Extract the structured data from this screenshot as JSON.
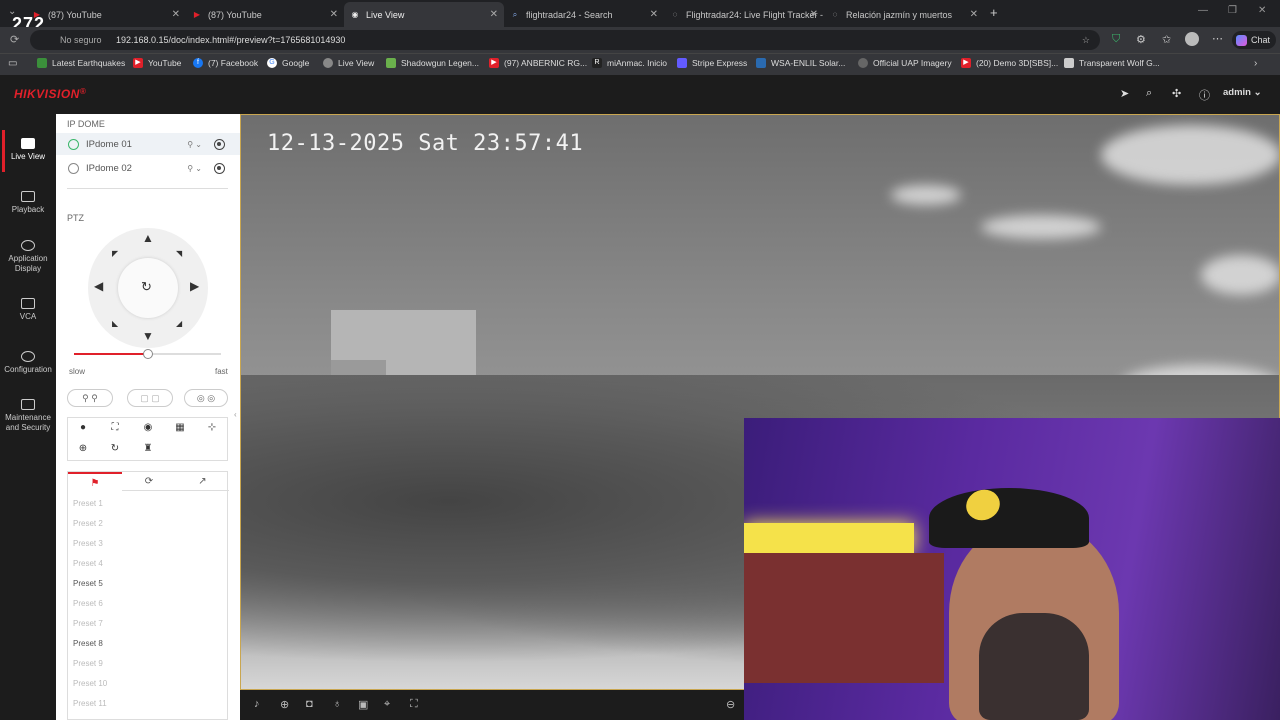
{
  "browser": {
    "tabs": [
      {
        "title": "(87) YouTube",
        "icon": "youtube-icon"
      },
      {
        "title": "(87) YouTube",
        "icon": "youtube-icon"
      },
      {
        "title": "Live View",
        "icon": "page-icon"
      },
      {
        "title": "flightradar24 - Search",
        "icon": "search-icon"
      },
      {
        "title": "Flightradar24: Live Flight Tracker -",
        "icon": "globe-icon"
      },
      {
        "title": "Relación jazmín y muertos",
        "icon": "globe-icon"
      }
    ],
    "address_prefix": "No seguro",
    "url": "192.168.0.15/doc/index.html#/preview?t=1765681014930",
    "chat_label": "Chat",
    "overlay_number": "272",
    "bookmarks": [
      {
        "label": "Latest Earthquakes",
        "color": "#3b8f3b"
      },
      {
        "label": "YouTube",
        "color": "#e0202a"
      },
      {
        "label": "(7) Facebook",
        "color": "#1877f2"
      },
      {
        "label": "Google",
        "color": "#ffffff"
      },
      {
        "label": "Live View",
        "color": "#888888"
      },
      {
        "label": "Shadowgun Legen...",
        "color": "#6ab04c"
      },
      {
        "label": "(97) ANBERNIC RG...",
        "color": "#e0202a"
      },
      {
        "label": "miAnmac. Inicio",
        "color": "#222222"
      },
      {
        "label": "Stripe Express",
        "color": "#635bff"
      },
      {
        "label": "WSA-ENLIL Solar...",
        "color": "#2a6ab0"
      },
      {
        "label": "Official UAP Imagery",
        "color": "#666666"
      },
      {
        "label": "(20) Demo 3D[SBS]...",
        "color": "#e0202a"
      },
      {
        "label": "Transparent Wolf G...",
        "color": "#cccccc"
      }
    ]
  },
  "app": {
    "brand": "HIKVISION",
    "brand_mark": "®",
    "user": "admin",
    "leftnav": [
      {
        "label": "Live View",
        "icon": "live-view-icon"
      },
      {
        "label": "Playback",
        "icon": "playback-icon"
      },
      {
        "label": "Application Display",
        "icon": "application-icon"
      },
      {
        "label": "VCA",
        "icon": "vca-icon"
      },
      {
        "label": "Configuration",
        "icon": "gear-icon"
      },
      {
        "label": "Maintenance and Security",
        "icon": "maintenance-icon"
      }
    ]
  },
  "panel": {
    "group_title": "IP DOME",
    "cameras": [
      {
        "name": "IPdome 01"
      },
      {
        "name": "IPdome 02"
      }
    ],
    "ptz_title": "PTZ",
    "speed_slow": "slow",
    "speed_fast": "fast",
    "speed_level": 0.5,
    "presets": [
      "Preset 1",
      "Preset 2",
      "Preset 3",
      "Preset 4",
      "Preset 5",
      "Preset 6",
      "Preset 7",
      "Preset 8",
      "Preset 9",
      "Preset 10",
      "Preset 11"
    ],
    "presets_enabled": [
      "Preset 5",
      "Preset 8"
    ]
  },
  "video": {
    "timestamp": "12-13-2025 Sat 23:57:41"
  }
}
